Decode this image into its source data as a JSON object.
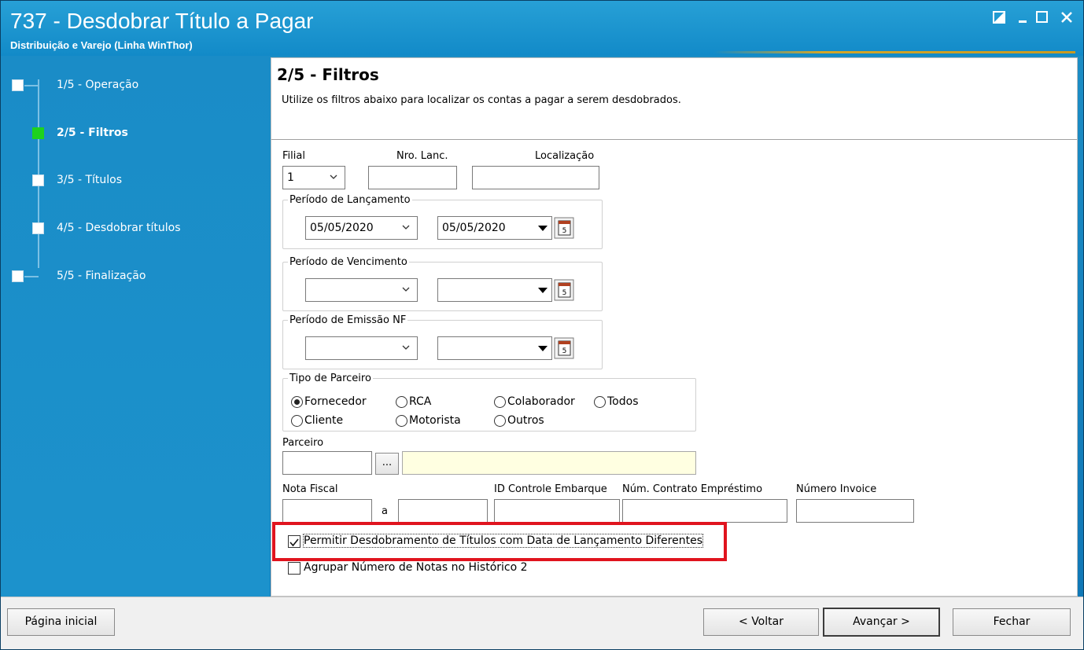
{
  "window": {
    "title": "737 - Desdobrar Título a Pagar",
    "subtitle": "Distribuição e Varejo (Linha WinThor)"
  },
  "steps": [
    {
      "label": "1/5 - Operação",
      "current": false
    },
    {
      "label": "2/5 - Filtros",
      "current": true
    },
    {
      "label": "3/5 - Títulos",
      "current": false
    },
    {
      "label": "4/5 - Desdobrar títulos",
      "current": false
    },
    {
      "label": "5/5 - Finalização",
      "current": false
    }
  ],
  "page": {
    "title": "2/5 - Filtros",
    "description": "Utilize os filtros abaixo para localizar os contas a pagar a serem desdobrados."
  },
  "filters": {
    "filial_label": "Filial",
    "filial_value": "1",
    "nro_lanc_label": "Nro. Lanc.",
    "nro_lanc_value": "",
    "localizacao_label": "Localização",
    "localizacao_value": "",
    "periodo_lancamento": {
      "legend": "Período de Lançamento",
      "start": "05/05/2020",
      "end": "05/05/2020"
    },
    "periodo_vencimento": {
      "legend": "Período de Vencimento",
      "start": "",
      "end": ""
    },
    "periodo_emissao": {
      "legend": "Período de Emissão NF",
      "start": "",
      "end": ""
    },
    "tipo_parceiro": {
      "legend": "Tipo de Parceiro",
      "options": [
        "Fornecedor",
        "RCA",
        "Colaborador",
        "Todos",
        "Cliente",
        "Motorista",
        "Outros"
      ],
      "selected": "Fornecedor"
    },
    "parceiro_label": "Parceiro",
    "parceiro_browse": "...",
    "nota_fiscal_label": "Nota Fiscal",
    "nota_fiscal_sep": "a",
    "id_controle_label": "ID Controle Embarque",
    "num_contrato_label": "Núm. Contrato Empréstimo",
    "numero_invoice_label": "Número Invoice",
    "permitir_desdobramento": {
      "label": "Permitir Desdobramento de  Títulos com Data de Lançamento Diferentes",
      "checked": true
    },
    "agrupar_notas": {
      "label": "Agrupar Número de Notas no Histórico 2",
      "checked": false
    }
  },
  "footer": {
    "home": "Página inicial",
    "back": "< Voltar",
    "next": "Avançar >",
    "close": "Fechar"
  },
  "colors": {
    "titlebar": "#1d8fc6",
    "current_step": "#1ed21e",
    "highlight": "#e0141e",
    "partner_name_field": "#ffffe1"
  }
}
